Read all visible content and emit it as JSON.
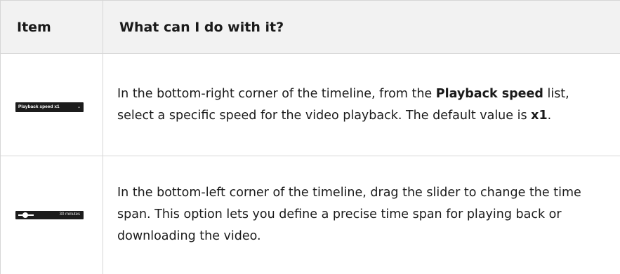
{
  "table": {
    "headers": {
      "item": "Item",
      "description": "What can I do with it?"
    },
    "rows": [
      {
        "icon": {
          "name": "playback-speed-dropdown",
          "label": "Playback speed x1",
          "chevron": "⌄"
        },
        "description": {
          "part1": "In the bottom-right corner of the timeline, from the ",
          "bold1": "Playback speed",
          "part2": " list, select a specific speed for the video playback. The default value is ",
          "bold2": "x1",
          "part3": "."
        }
      },
      {
        "icon": {
          "name": "time-span-slider",
          "label": "30 minutes"
        },
        "description": {
          "text": "In the bottom-left corner of the timeline, drag the slider to change the time span. This option lets you define a precise time span for playing back or downloading the video."
        }
      }
    ]
  },
  "colors": {
    "header_background": "#f2f2f2",
    "border": "#d6d6d6",
    "control_background": "#1c1c1c"
  }
}
